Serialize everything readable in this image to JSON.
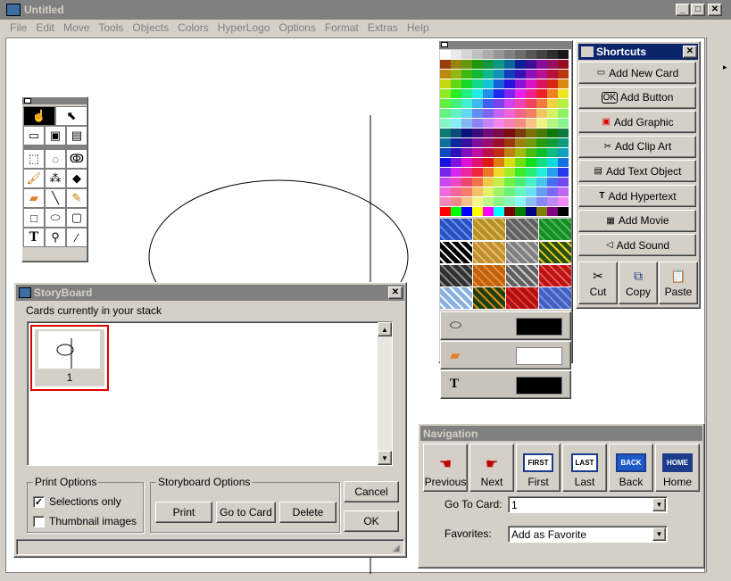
{
  "window": {
    "title": "Untitled"
  },
  "menu": [
    "File",
    "Edit",
    "Move",
    "Tools",
    "Objects",
    "Colors",
    "HyperLogo",
    "Options",
    "Format",
    "Extras",
    "Help"
  ],
  "shortcuts": {
    "title": "Shortcuts",
    "items": [
      {
        "label": "Add New Card",
        "icon": "card-icon"
      },
      {
        "label": "Add Button",
        "icon": "ok-button-icon"
      },
      {
        "label": "Add Graphic",
        "icon": "graphic-icon"
      },
      {
        "label": "Add Clip Art",
        "icon": "clip-art-icon"
      },
      {
        "label": "Add Text Object",
        "icon": "text-object-icon"
      },
      {
        "label": "Add Hypertext",
        "icon": "hypertext-icon"
      },
      {
        "label": "Add Movie",
        "icon": "movie-icon"
      },
      {
        "label": "Add Sound",
        "icon": "sound-icon"
      }
    ],
    "edit": [
      {
        "label": "Cut",
        "icon": "scissors-icon"
      },
      {
        "label": "Copy",
        "icon": "copy-icon"
      },
      {
        "label": "Paste",
        "icon": "paste-icon"
      }
    ]
  },
  "storyboard": {
    "title": "StoryBoard",
    "caption": "Cards currently in your stack",
    "cards": [
      {
        "number": "1"
      }
    ],
    "print_options": {
      "legend": "Print Options",
      "selections_only": {
        "label": "Selections only",
        "checked": true
      },
      "thumbnail_images": {
        "label": "Thumbnail images",
        "checked": false
      }
    },
    "storyboard_options": {
      "legend": "Storyboard Options",
      "print": "Print",
      "go_to_card": "Go to Card",
      "delete": "Delete"
    },
    "cancel": "Cancel",
    "ok": "OK"
  },
  "navigation": {
    "title": "Navigation",
    "buttons": [
      {
        "label": "Previous",
        "icon": "hand-left-icon"
      },
      {
        "label": "Next",
        "icon": "hand-right-icon"
      },
      {
        "label": "First",
        "icon": "first-card-icon",
        "badge": "FIRST"
      },
      {
        "label": "Last",
        "icon": "last-card-icon",
        "badge": "LAST"
      },
      {
        "label": "Back",
        "icon": "back-arrow-icon",
        "badge": "BACK"
      },
      {
        "label": "Home",
        "icon": "home-icon",
        "badge": "HOME"
      }
    ],
    "go_to_card": {
      "label": "Go To Card:",
      "value": "1"
    },
    "favorites": {
      "label": "Favorites:",
      "value": "Add as Favorite"
    }
  },
  "palette": {
    "styles": [
      {
        "icon": "ellipse-icon",
        "color": "#000000"
      },
      {
        "icon": "eraser-icon",
        "color": "#ffffff"
      },
      {
        "icon": "text-icon",
        "color": "#000000"
      }
    ]
  }
}
